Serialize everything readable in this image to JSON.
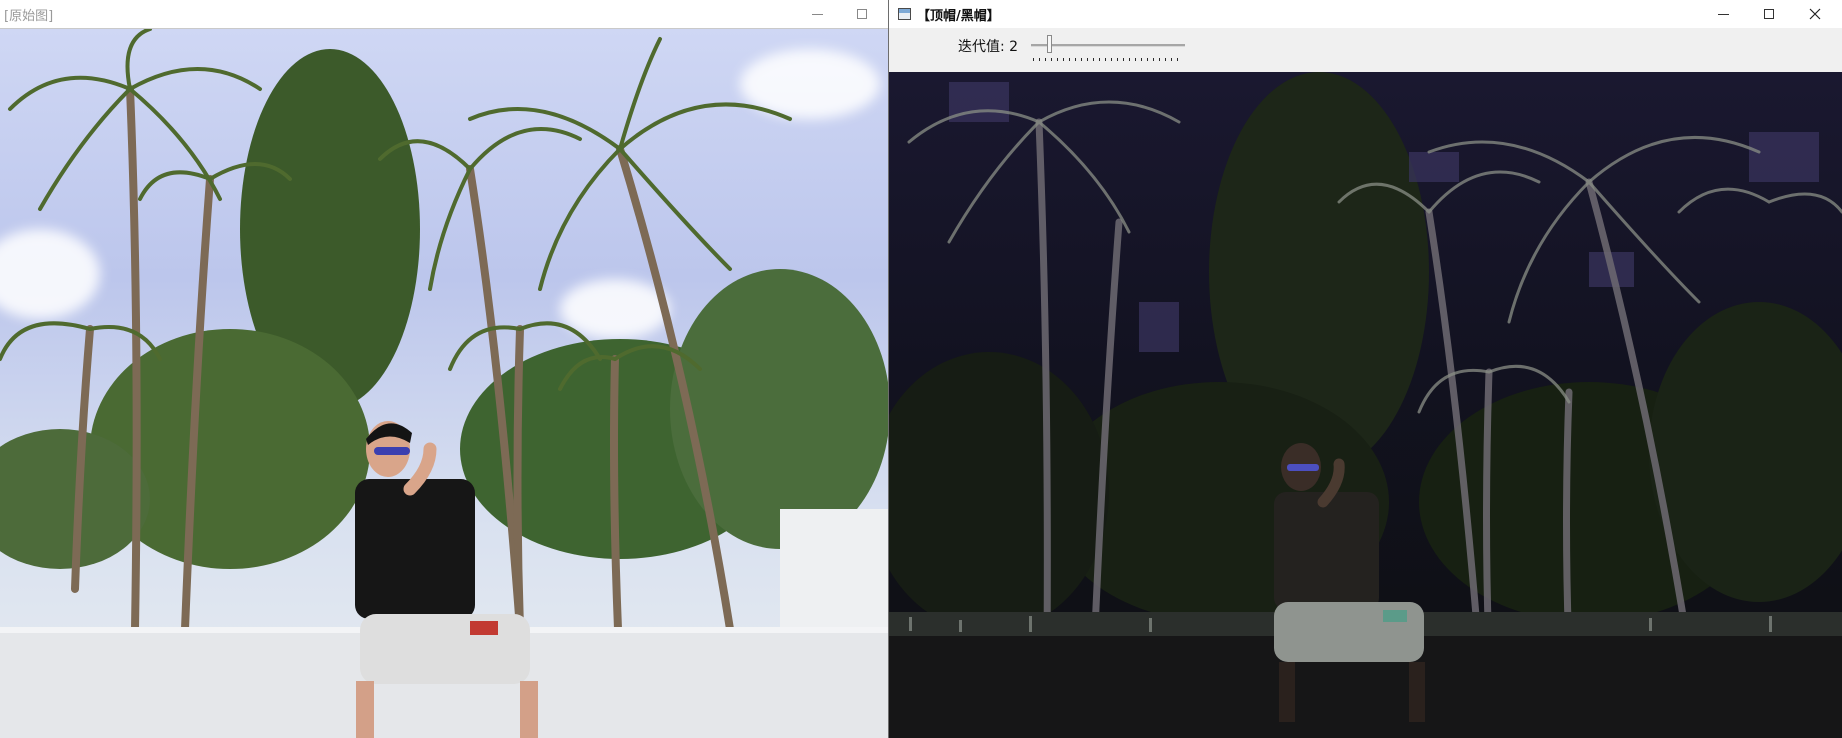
{
  "left_window": {
    "title": "[原始图]",
    "image_description_label": "photo-original"
  },
  "right_window": {
    "title": "【顶帽/黑帽】",
    "trackbar": {
      "label": "迭代值: 2",
      "value": 2
    }
  },
  "colors": {
    "titlebar": "#ffffff",
    "toolbar": "#f0f0f0",
    "tophat_background": "#0f0f14",
    "original_sky": "#c8d0f0"
  },
  "icons": {
    "app_icon": "window-app-icon",
    "minimize": "minimize-icon",
    "maximize": "maximize-icon",
    "close": "close-icon"
  }
}
